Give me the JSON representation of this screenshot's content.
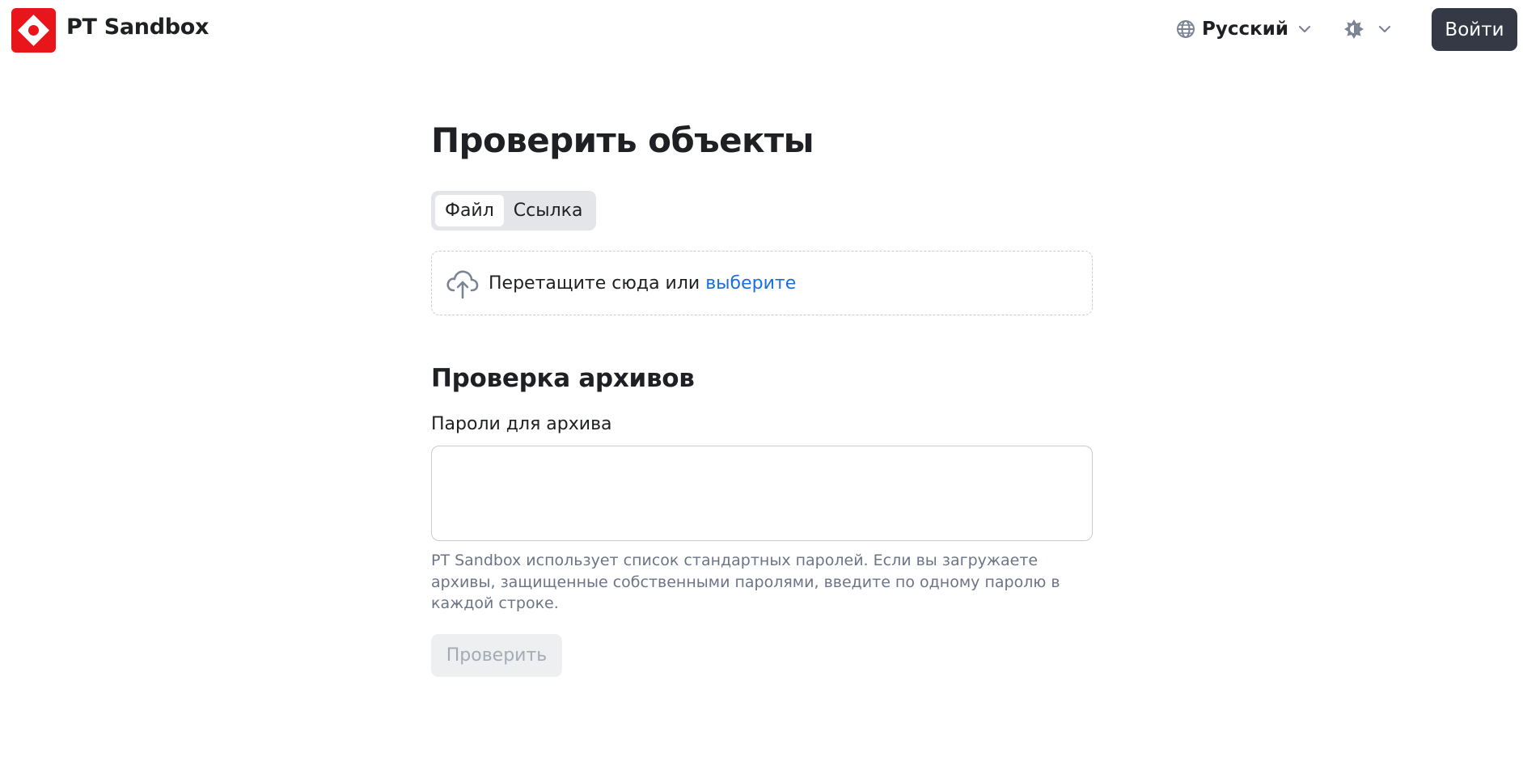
{
  "header": {
    "brand": "PT Sandbox",
    "language": {
      "label": "Русский",
      "icon": "globe-icon"
    },
    "theme": {
      "icon": "sun-icon"
    },
    "login_label": "Войти"
  },
  "main": {
    "title": "Проверить объекты",
    "tabs": [
      {
        "label": "Файл",
        "active": true
      },
      {
        "label": "Ссылка",
        "active": false
      }
    ],
    "dropzone": {
      "text": "Перетащите сюда или",
      "link": "выберите",
      "icon": "cloud-upload-icon"
    },
    "archive": {
      "title": "Проверка архивов",
      "label": "Пароли для архива",
      "value": "",
      "hint": "PT Sandbox использует список стандартных паролей. Если вы загружаете архивы, защищенные собственными паролями, введите по одному паролю в каждой строке."
    },
    "submit_label": "Проверить"
  },
  "colors": {
    "brand": "#e8151b",
    "link": "#1a6fe0",
    "primary_button": "#353946",
    "muted_text": "#6c7586",
    "disabled_button": "#eeeff1"
  }
}
